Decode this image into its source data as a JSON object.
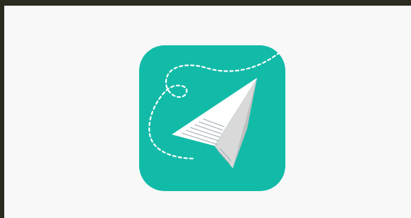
{
  "screen": {
    "background": "#f8f8f8",
    "frame_color": "#2b2b20"
  },
  "app_icon": {
    "icon": "paper-plane-icon",
    "background_color": "#12bba8",
    "plane_colors": [
      "#ffffff",
      "#f2f2f2",
      "#d9d9d9",
      "#bfbfbf"
    ],
    "flight_path": "dashed-loop",
    "path_color": "#ffffff"
  }
}
